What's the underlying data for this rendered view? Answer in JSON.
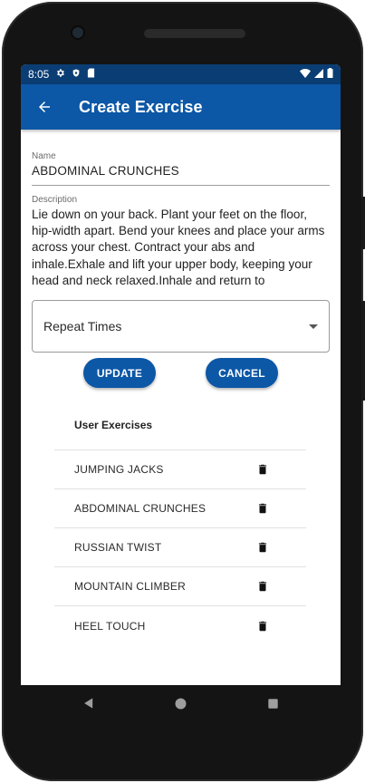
{
  "status_bar": {
    "time": "8:05"
  },
  "app_bar": {
    "title": "Create Exercise"
  },
  "form": {
    "name_label": "Name",
    "name_value": "ABDOMINAL CRUNCHES",
    "description_label": "Description",
    "description_value": "Lie down on your back. Plant your feet on the floor, hip-width apart. Bend your knees and place your arms across your chest. Contract your abs and inhale.Exhale and lift your upper body, keeping your head and neck relaxed.Inhale and return to",
    "repeat_select": "Repeat Times",
    "update_label": "UPDATE",
    "cancel_label": "CANCEL"
  },
  "user_exercises": {
    "header": "User Exercises",
    "items": [
      {
        "name": "JUMPING JACKS"
      },
      {
        "name": "ABDOMINAL CRUNCHES"
      },
      {
        "name": "RUSSIAN TWIST"
      },
      {
        "name": "MOUNTAIN CLIMBER"
      },
      {
        "name": "HEEL TOUCH"
      }
    ]
  },
  "icons": {
    "back": "arrow-back-icon",
    "delete": "trash-icon",
    "dropdown": "dropdown-caret-icon"
  },
  "colors": {
    "primary": "#0c57a6",
    "status_bar": "#0a3d73"
  }
}
